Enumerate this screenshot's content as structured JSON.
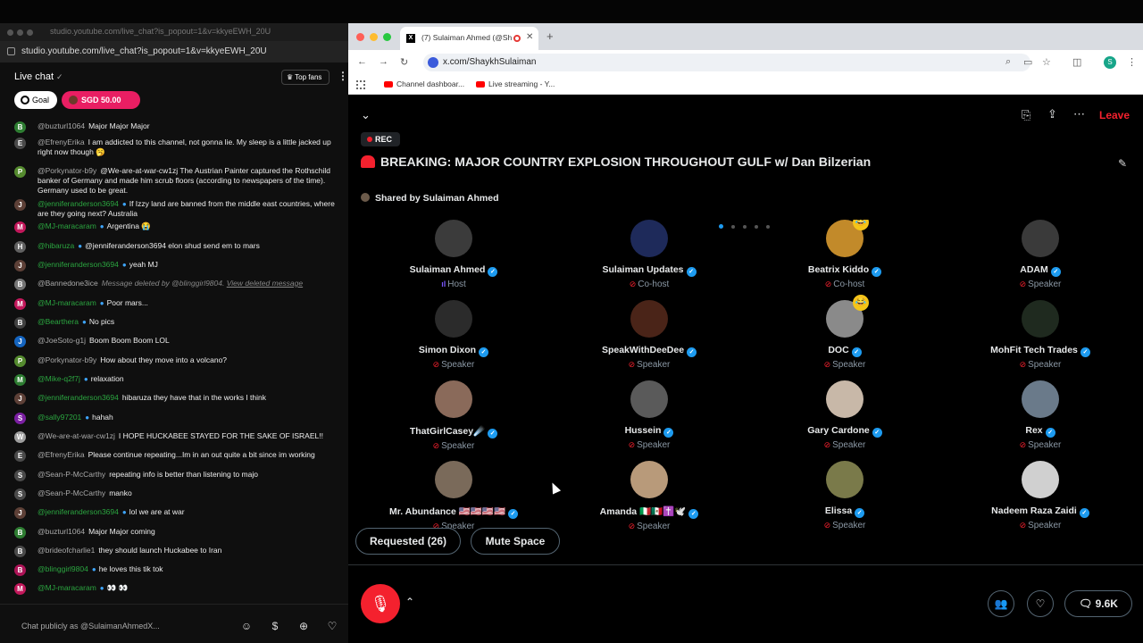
{
  "left": {
    "url_faded": "studio.youtube.com/live_chat?is_popout=1&v=kkyeEWH_20U",
    "url": "studio.youtube.com/live_chat?is_popout=1&v=kkyeEWH_20U",
    "chat_title": "Live chat",
    "top_fans": "Top fans",
    "goal_label": "Goal",
    "amount": "SGD 50.00",
    "input_placeholder": "Chat publicly as @SulaimanAhmedX...",
    "messages": [
      {
        "avatar": "B",
        "color": "#2e7d32",
        "author": "@buzturl1064",
        "verified": false,
        "member": false,
        "text": "Major Major Major",
        "deleted": false
      },
      {
        "avatar": "E",
        "color": "#4a4a4a",
        "author": "@EfrenyErika",
        "verified": false,
        "member": false,
        "text": "I am addicted to this channel, not gonna lie. My sleep is a little jacked up right now though 🥱",
        "deleted": false
      },
      {
        "avatar": "P",
        "color": "#558b2f",
        "author": "@Porkynator-b9y",
        "verified": false,
        "member": false,
        "text": "@We-are-at-war-cw1zj The Austrian Painter captured the Rothschild banker of Germany and made him scrub floors (according to newspapers of the time). Germany used to be great.",
        "deleted": false
      },
      {
        "avatar": "J",
        "color": "#5d4037",
        "author": "@jenniferanderson3694",
        "verified": true,
        "member": true,
        "text": "If Izzy land are banned from the middle east countries, where are they going next? Australia",
        "deleted": false
      },
      {
        "avatar": "M",
        "color": "#c2185b",
        "author": "@MJ-maracaram",
        "verified": true,
        "member": true,
        "text": "Argentina 😭",
        "deleted": false
      },
      {
        "avatar": "H",
        "color": "#616161",
        "author": "@hibaruza",
        "verified": true,
        "member": true,
        "text": "@jenniferanderson3694 elon shud send em to mars",
        "deleted": false
      },
      {
        "avatar": "J",
        "color": "#5d4037",
        "author": "@jenniferanderson3694",
        "verified": true,
        "member": true,
        "text": "yeah MJ",
        "deleted": false
      },
      {
        "avatar": "B",
        "color": "#757575",
        "author": "@Bannedone3ice",
        "verified": false,
        "member": false,
        "text": "Message deleted by @blinggirl9804.",
        "link": "View deleted message",
        "deleted": true
      },
      {
        "avatar": "M",
        "color": "#c2185b",
        "author": "@MJ-maracaram",
        "verified": true,
        "member": true,
        "text": "Poor mars...",
        "deleted": false
      },
      {
        "avatar": "B",
        "color": "#424242",
        "author": "@Bearthera",
        "verified": true,
        "member": true,
        "text": "No pics",
        "deleted": false
      },
      {
        "avatar": "J",
        "color": "#1565c0",
        "author": "@JoeSoto-g1j",
        "verified": false,
        "member": false,
        "text": "Boom Boom Boom LOL",
        "deleted": false
      },
      {
        "avatar": "P",
        "color": "#558b2f",
        "author": "@Porkynator-b9y",
        "verified": false,
        "member": false,
        "text": "How about they move into a volcano?",
        "deleted": false
      },
      {
        "avatar": "M",
        "color": "#2e7d32",
        "author": "@Mike-q2f7j",
        "verified": true,
        "member": true,
        "text": "relaxation",
        "deleted": false
      },
      {
        "avatar": "J",
        "color": "#5d4037",
        "author": "@jenniferanderson3694",
        "verified": false,
        "member": true,
        "text": "hibaruza they have that in the works I think",
        "deleted": false
      },
      {
        "avatar": "S",
        "color": "#7b1fa2",
        "author": "@sally97201",
        "verified": true,
        "member": true,
        "text": "hahah",
        "deleted": false
      },
      {
        "avatar": "W",
        "color": "#9e9e9e",
        "author": "@We-are-at-war-cw1zj",
        "verified": false,
        "member": false,
        "text": "I HOPE HUCKABEE STAYED FOR THE SAKE OF ISRAEL!!",
        "deleted": false
      },
      {
        "avatar": "E",
        "color": "#4a4a4a",
        "author": "@EfrenyErika",
        "verified": false,
        "member": false,
        "text": "Please continue repeating...Im in an out quite a bit since im working",
        "deleted": false
      },
      {
        "avatar": "S",
        "color": "#4a4a4a",
        "author": "@Sean-P-McCarthy",
        "verified": false,
        "member": false,
        "text": "repeating info is better than listening to majo",
        "deleted": false
      },
      {
        "avatar": "S",
        "color": "#4a4a4a",
        "author": "@Sean-P-McCarthy",
        "verified": false,
        "member": false,
        "text": "manko",
        "deleted": false
      },
      {
        "avatar": "J",
        "color": "#5d4037",
        "author": "@jenniferanderson3694",
        "verified": true,
        "member": true,
        "text": "lol we are at war",
        "deleted": false
      },
      {
        "avatar": "B",
        "color": "#2e7d32",
        "author": "@buzturl1064",
        "verified": false,
        "member": false,
        "text": "Major Major coming",
        "deleted": false
      },
      {
        "avatar": "B",
        "color": "#4a4a4a",
        "author": "@brideofcharlie1",
        "verified": false,
        "member": false,
        "text": "they should launch Huckabee to Iran",
        "deleted": false
      },
      {
        "avatar": "B",
        "color": "#ad1457",
        "author": "@blinggirl9804",
        "verified": true,
        "member": true,
        "text": "he loves this tik tok",
        "deleted": false
      },
      {
        "avatar": "M",
        "color": "#c2185b",
        "author": "@MJ-maracaram",
        "verified": true,
        "member": true,
        "text": "👀 👀",
        "deleted": false
      }
    ]
  },
  "browser": {
    "tab_title": "(7) Sulaiman Ahmed (@Sh",
    "address": "x.com/ShaykhSulaiman",
    "bookmarks": [
      "Channel dashboar...",
      "Live streaming - Y..."
    ],
    "profile_initial": "S"
  },
  "space": {
    "leave": "Leave",
    "rec": "REC",
    "title": "BREAKING: MAJOR COUNTRY EXPLOSION THROUGHOUT GULF w/ Dan Bilzerian",
    "shared_by": "Shared by Sulaiman Ahmed",
    "participants": [
      {
        "name": "Sulaiman Ahmed",
        "role": "Host",
        "color": "#3b3b3b",
        "emoji": ""
      },
      {
        "name": "Sulaiman Updates",
        "role": "Co-host",
        "color": "#1e2a5a",
        "emoji": ""
      },
      {
        "name": "Beatrix Kiddo",
        "role": "Co-host",
        "color": "#c28a2a",
        "emoji": "😂"
      },
      {
        "name": "ADAM",
        "role": "Speaker",
        "color": "#3a3a3a",
        "emoji": ""
      },
      {
        "name": "Simon Dixon",
        "role": "Speaker",
        "color": "#2b2b2b",
        "emoji": ""
      },
      {
        "name": "SpeakWithDeeDee",
        "role": "Speaker",
        "color": "#4a2418",
        "emoji": ""
      },
      {
        "name": "DOC",
        "role": "Speaker",
        "color": "#8a8a8a",
        "emoji": "😂"
      },
      {
        "name": "MohFit Tech Trades",
        "role": "Speaker",
        "color": "#1f2a1f",
        "emoji": ""
      },
      {
        "name": "ThatGirlCasey☄️",
        "role": "Speaker",
        "color": "#8a6a5a",
        "emoji": ""
      },
      {
        "name": "Hussein",
        "role": "Speaker",
        "color": "#5a5a5a",
        "emoji": ""
      },
      {
        "name": "Gary Cardone",
        "role": "Speaker",
        "color": "#c8b8a8",
        "emoji": ""
      },
      {
        "name": "Rex",
        "role": "Speaker",
        "color": "#6a7a8a",
        "emoji": ""
      },
      {
        "name": "Mr. Abundance 🇺🇸🇺🇸🇺🇸🇺🇸",
        "role": "Speaker",
        "color": "#7a6a5a",
        "emoji": ""
      },
      {
        "name": "Amanda 🇮🇹🇲🇽✝️🕊️",
        "role": "Speaker",
        "color": "#b89a7a",
        "emoji": ""
      },
      {
        "name": "Elissa",
        "role": "Speaker",
        "color": "#7a7a4a",
        "emoji": ""
      },
      {
        "name": "Nadeem Raza Zaidi",
        "role": "Speaker",
        "color": "#d0d0d0",
        "emoji": ""
      }
    ],
    "requested": "Requested (26)",
    "mute_space": "Mute Space",
    "count": "9.6K"
  }
}
